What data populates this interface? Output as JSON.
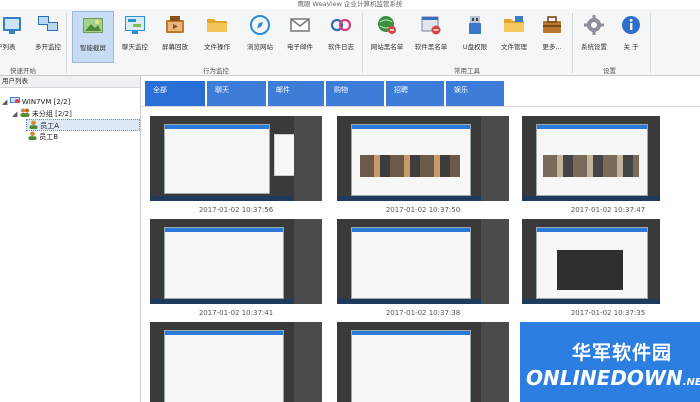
{
  "window": {
    "title": "鹰眼 WeaView 企业计算机监管系统"
  },
  "toolbar": {
    "items": [
      {
        "label": "户列表",
        "icon": "user-list-icon",
        "color": "#3a7fc4"
      },
      {
        "label": "多开监控",
        "icon": "multi-monitor-icon",
        "color": "#2a6fb8"
      },
      {
        "label": "智能截屏",
        "icon": "screenshot-icon",
        "color": "#5aa14d"
      },
      {
        "label": "聊天监控",
        "icon": "chat-monitor-icon",
        "color": "#2e8fd1"
      },
      {
        "label": "屏幕回放",
        "icon": "playback-icon",
        "color": "#c0782b"
      },
      {
        "label": "文件操作",
        "icon": "folder-icon",
        "color": "#e0a82e"
      },
      {
        "label": "浏览网站",
        "icon": "browser-icon",
        "color": "#2a8ad6"
      },
      {
        "label": "电子邮件",
        "icon": "email-icon",
        "color": "#777777"
      },
      {
        "label": "软件日志",
        "icon": "software-log-icon",
        "color": "#3467b9"
      },
      {
        "label": "网站黑名单",
        "icon": "website-blacklist-icon",
        "color": "#3a8f3a"
      },
      {
        "label": "软件黑名单",
        "icon": "software-blacklist-icon",
        "color": "#d34343"
      },
      {
        "label": "U盘权限",
        "icon": "usb-icon",
        "color": "#3b77c9"
      },
      {
        "label": "文件管理",
        "icon": "file-manage-icon",
        "color": "#e4a32a"
      },
      {
        "label": "更多...",
        "icon": "more-icon",
        "color": "#b8772e"
      },
      {
        "label": "系统设置",
        "icon": "gear-icon",
        "color": "#8a8f99"
      },
      {
        "label": "关 于",
        "icon": "info-icon",
        "color": "#2f6fc9"
      }
    ],
    "groups": [
      "快速开始",
      "行为监控",
      "常用工具",
      "设置"
    ]
  },
  "sidebar": {
    "header": "用户列表",
    "tree": [
      {
        "label": "WIN7VM",
        "count": "[2/2]"
      },
      {
        "label": "未分组",
        "count": "[2/2]"
      },
      {
        "label": "员工A"
      },
      {
        "label": "员工B"
      }
    ]
  },
  "tabs": [
    "全部",
    "聊天",
    "邮件",
    "购物",
    "招聘",
    "娱乐"
  ],
  "thumbnails": [
    {
      "time": "2017-01-02 10:37:56"
    },
    {
      "time": "2017-01-02 10:37:50"
    },
    {
      "time": "2017-01-02 10:37:47"
    },
    {
      "time": "2017-01-02 10:37:41"
    },
    {
      "time": "2017-01-02 10:37:38"
    },
    {
      "time": "2017-01-02 10:37:35"
    }
  ],
  "watermark": {
    "cn": "华军软件园",
    "en": "ONLINEDOWN",
    "suffix": ".NET"
  }
}
